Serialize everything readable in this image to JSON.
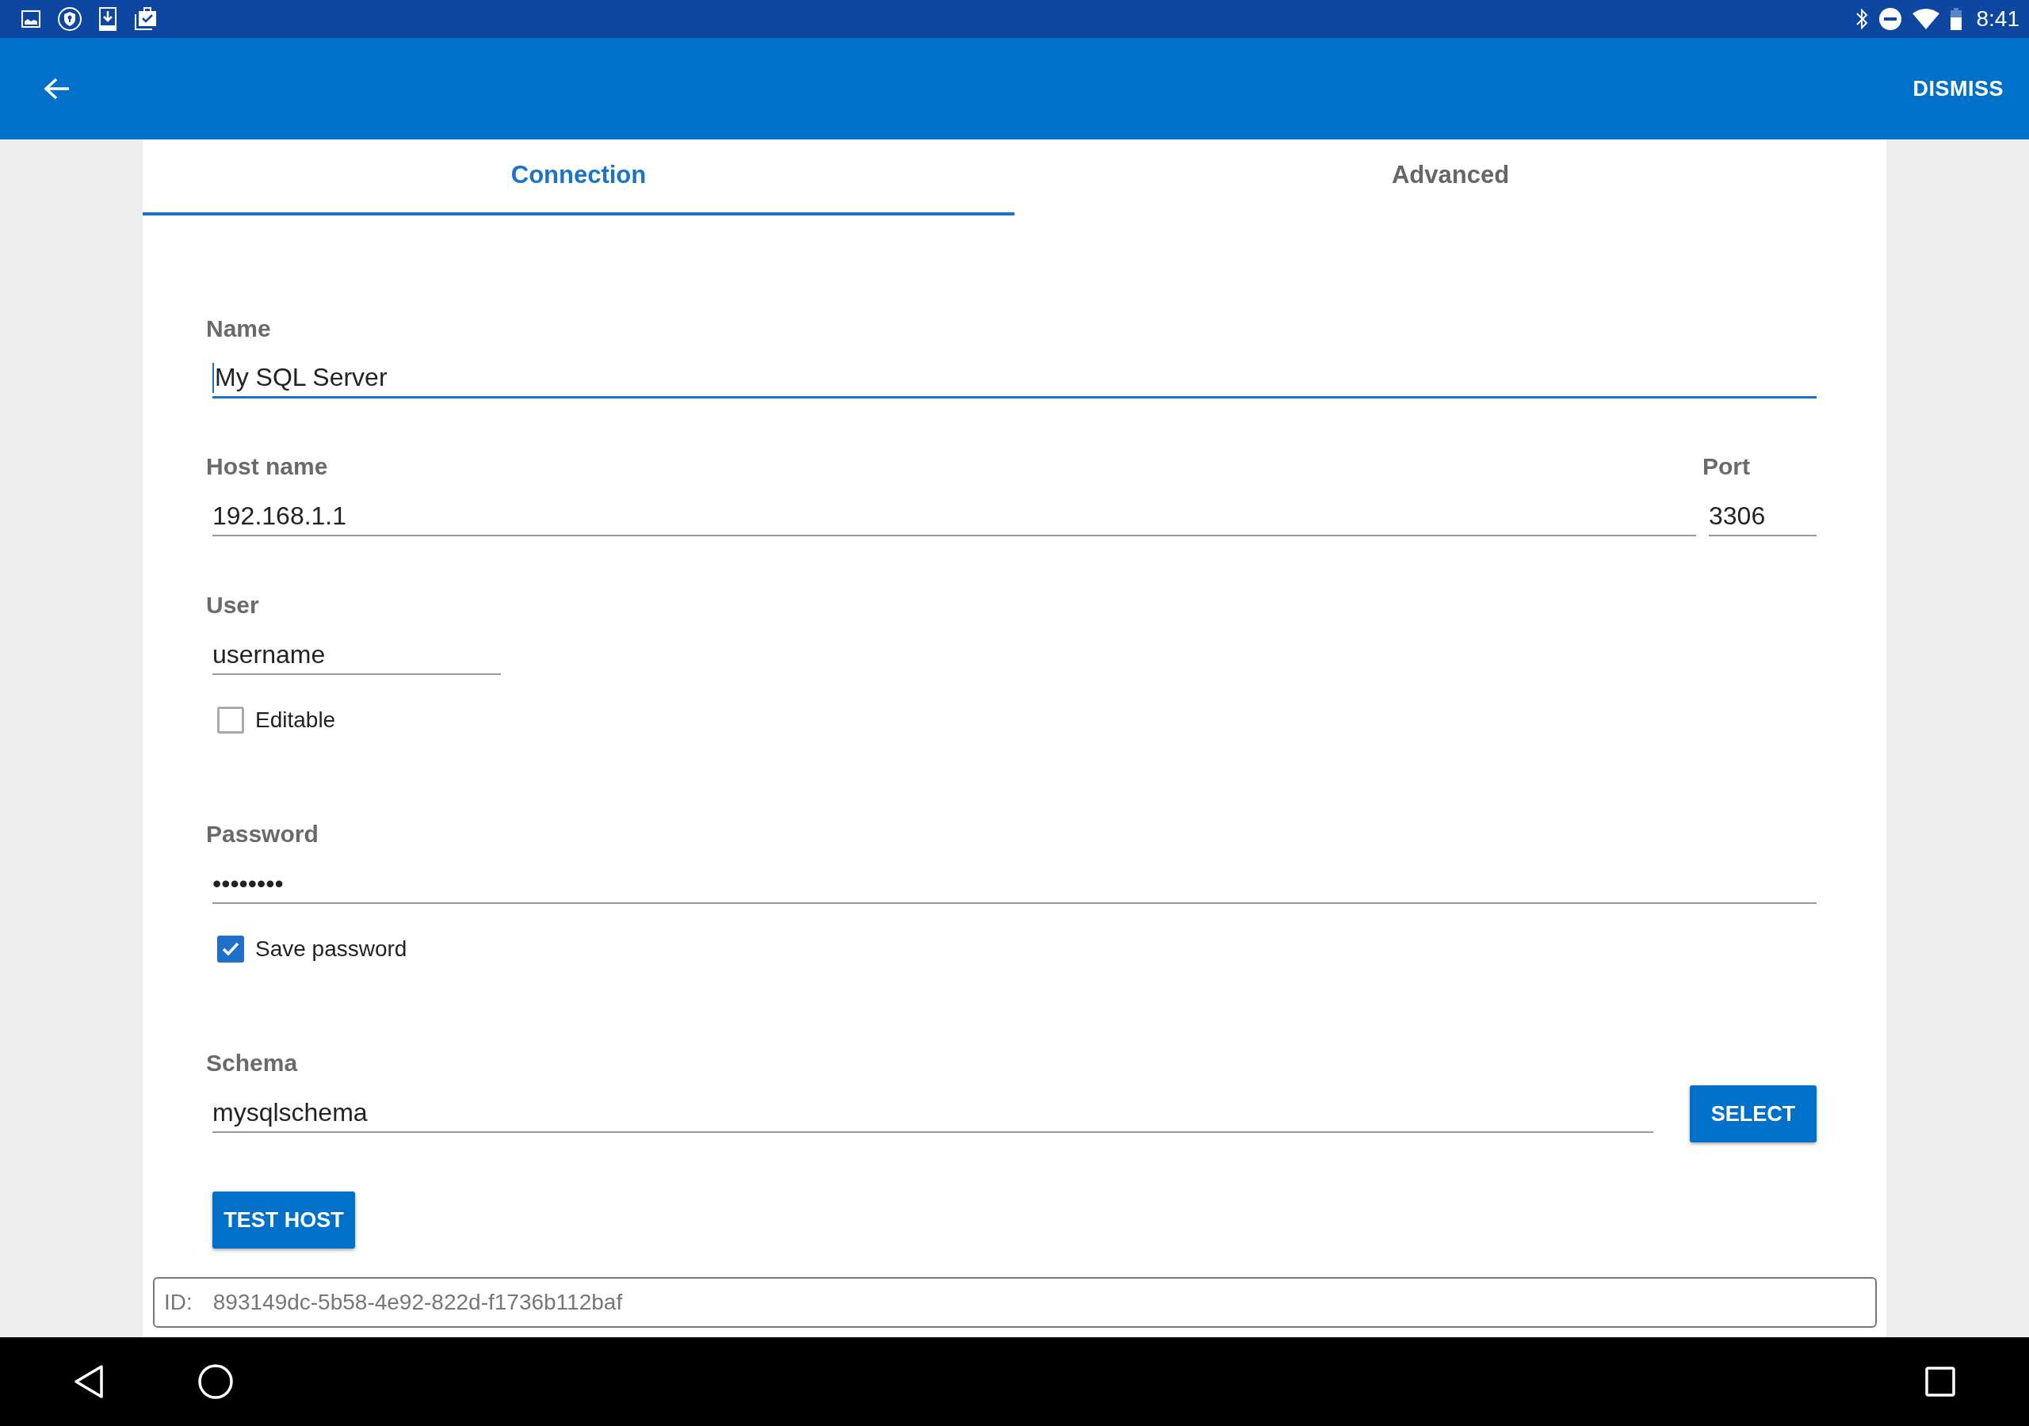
{
  "status_bar": {
    "time": "8:41"
  },
  "app_bar": {
    "action": "DISMISS"
  },
  "tabs": [
    {
      "label": "Connection",
      "selected": true
    },
    {
      "label": "Advanced",
      "selected": false
    }
  ],
  "form": {
    "name": {
      "label": "Name",
      "value": "My SQL Server",
      "focused": true
    },
    "host": {
      "label": "Host name",
      "value": "192.168.1.1",
      "focused": false
    },
    "port": {
      "label": "Port",
      "value": "3306",
      "focused": false
    },
    "user": {
      "label": "User",
      "value": "username",
      "focused": false
    },
    "editable": {
      "label": "Editable",
      "checked": false
    },
    "password": {
      "label": "Password",
      "value": "••••••••",
      "focused": false
    },
    "save_password": {
      "label": "Save password",
      "checked": true
    },
    "schema": {
      "label": "Schema",
      "value": "mysqlschema",
      "focused": false
    },
    "select_button": "SELECT",
    "test_button": "TEST HOST"
  },
  "id_bar": {
    "label": "ID:",
    "value": "893149dc-5b58-4e92-822d-f1736b112baf"
  }
}
